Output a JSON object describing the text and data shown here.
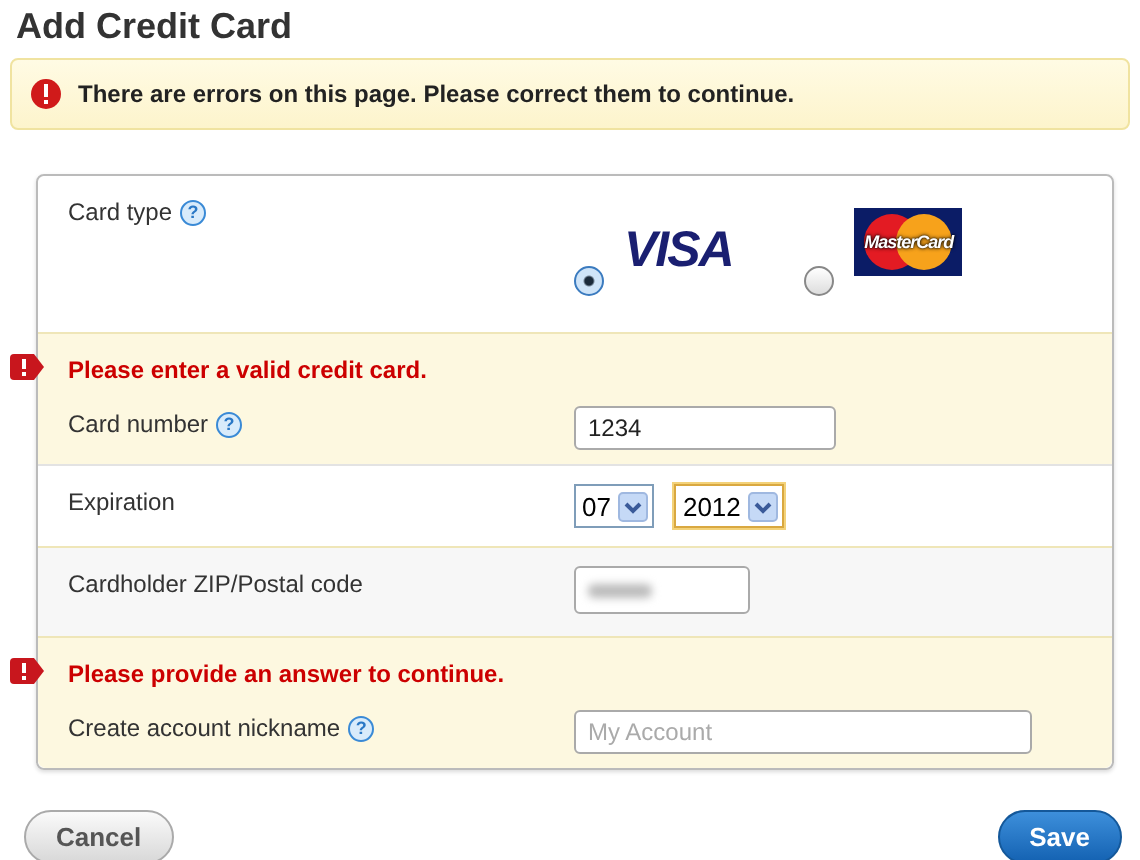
{
  "title": "Add Credit Card",
  "alert": "There are errors on this page. Please correct them to continue.",
  "rows": [
    {
      "kind": "cardtype",
      "label": "Card type",
      "help": "?",
      "options": [
        {
          "logo": "VISA",
          "kind": "visa",
          "selected": true
        },
        {
          "logo": "MasterCard",
          "kind": "mastercard",
          "selected": false
        }
      ]
    },
    {
      "kind": "number",
      "label": "Card number",
      "help": "?",
      "error": "Please enter a valid credit card.",
      "value": "1234"
    },
    {
      "kind": "expiry",
      "label": "Expiration",
      "selects": [
        {
          "value": "07",
          "focused": false
        },
        {
          "value": "2012",
          "focused": true
        }
      ]
    },
    {
      "kind": "postal",
      "label": "Cardholder ZIP/Postal code"
    },
    {
      "kind": "nickname",
      "label": "Create account nickname",
      "help": "?",
      "error": "Please provide an answer to continue.",
      "placeholder": "My Account"
    }
  ],
  "buttons": {
    "cancel": "Cancel",
    "save": "Save"
  }
}
